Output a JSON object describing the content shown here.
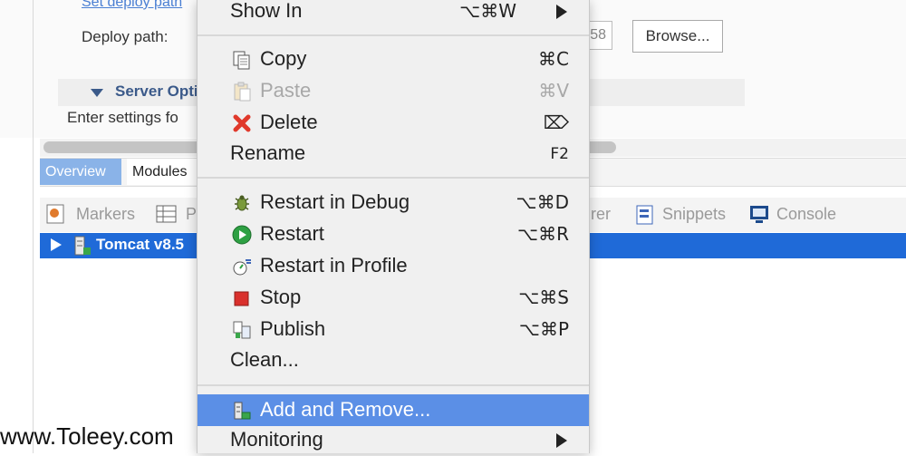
{
  "editor": {
    "set_deploy_path_link": "Set deploy path",
    "deploy_path_label": "Deploy path:",
    "deploy_path_value": "58",
    "browse_button": "Browse...",
    "server_options_title": "Server Optio",
    "server_options_desc": "Enter settings fo",
    "tabs": [
      "Overview",
      "Modules"
    ]
  },
  "views": {
    "tabs": [
      "Markers",
      "P",
      "rer",
      "Snippets",
      "Console"
    ],
    "server_row_label": "Tomcat v8.5"
  },
  "context_menu": {
    "items": [
      {
        "label": "Show In",
        "shortcut": "⌥⌘W",
        "submenu": true
      },
      {
        "label": "Copy",
        "shortcut": "⌘C"
      },
      {
        "label": "Paste",
        "shortcut": "⌘V",
        "disabled": true
      },
      {
        "label": "Delete",
        "shortcut": "⌦"
      },
      {
        "label": "Rename",
        "shortcut": "F2"
      },
      {
        "label": "Restart in Debug",
        "shortcut": "⌥⌘D"
      },
      {
        "label": "Restart",
        "shortcut": "⌥⌘R"
      },
      {
        "label": "Restart in Profile",
        "shortcut": ""
      },
      {
        "label": "Stop",
        "shortcut": "⌥⌘S"
      },
      {
        "label": "Publish",
        "shortcut": "⌥⌘P"
      },
      {
        "label": "Clean...",
        "shortcut": ""
      },
      {
        "label": "Add and Remove...",
        "shortcut": "",
        "highlighted": true
      },
      {
        "label": "Monitoring",
        "shortcut": "",
        "submenu": true
      }
    ]
  },
  "watermark": "www.Toleey.com",
  "colors": {
    "selection_blue": "#1f6ad8",
    "menu_highlight": "#5b8fe6",
    "delete_red": "#e0392b",
    "restart_green": "#2ea043",
    "stop_red": "#d9302c"
  }
}
